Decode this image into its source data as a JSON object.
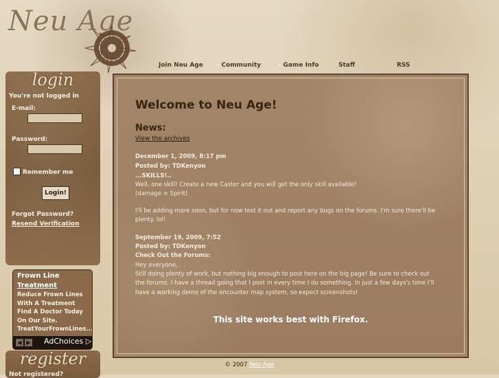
{
  "header": {
    "logo_text": "Neu Age"
  },
  "nav": [
    {
      "label": "Join Neu Age"
    },
    {
      "label": "Community"
    },
    {
      "label": "Game Info"
    },
    {
      "label": "Staff"
    },
    {
      "label": "RSS"
    }
  ],
  "login": {
    "heading": "login",
    "status": "You're not logged in",
    "email_label": "E-mail:",
    "password_label": "Password:",
    "remember_label": "Remember me",
    "button_label": "Login!",
    "forgot_label": "Forgot Password?",
    "resend_label": "Resend Verification"
  },
  "ad": {
    "title_line1": "Frown Line",
    "title_line2": "Treatment",
    "body": "Reduce Frown Lines With A Treatment Find A Doctor Today On Our Site.",
    "url": "TreatYourFrownLines....",
    "choices_label": "AdChoices",
    "choices_icon": "▷",
    "prev_icon": "◀",
    "next_icon": "▶"
  },
  "register": {
    "heading": "register",
    "status": "Not registered?"
  },
  "main": {
    "welcome": "Welcome to Neu Age!",
    "news_heading": "News:",
    "archives_link": "View the archives",
    "posts": [
      {
        "date": "December 1, 2009, 8:17 pm",
        "author": "Posted by: TDKenyon",
        "title": "...SKILLS!..",
        "body1": "Well, one skill! Create a new Caster and you will get the only skill available!",
        "body2": "(damage = Spirit)",
        "body3": "I'll be adding more soon, but for now test it out and report any bugs on the forums. I'm sure there'll be plenty. lol!"
      },
      {
        "date": "September 19, 2009, 7:52",
        "author": "Posted by: TDKenyon",
        "title": "Check Out the Forums:",
        "body1": "Hey everyone,",
        "body2": "Still doing plenty of work, but nothing big enough to post here on the big page! Be sure to check out the forums. I have a thread going that I post in every time I do something. In just a few days's time I'll have a working demo of the encounter map system, so expect screenshots!"
      }
    ],
    "firefox_note": "This site works best with Firefox."
  },
  "footer": {
    "copyright": "© 2007",
    "link": "Neu Age"
  }
}
